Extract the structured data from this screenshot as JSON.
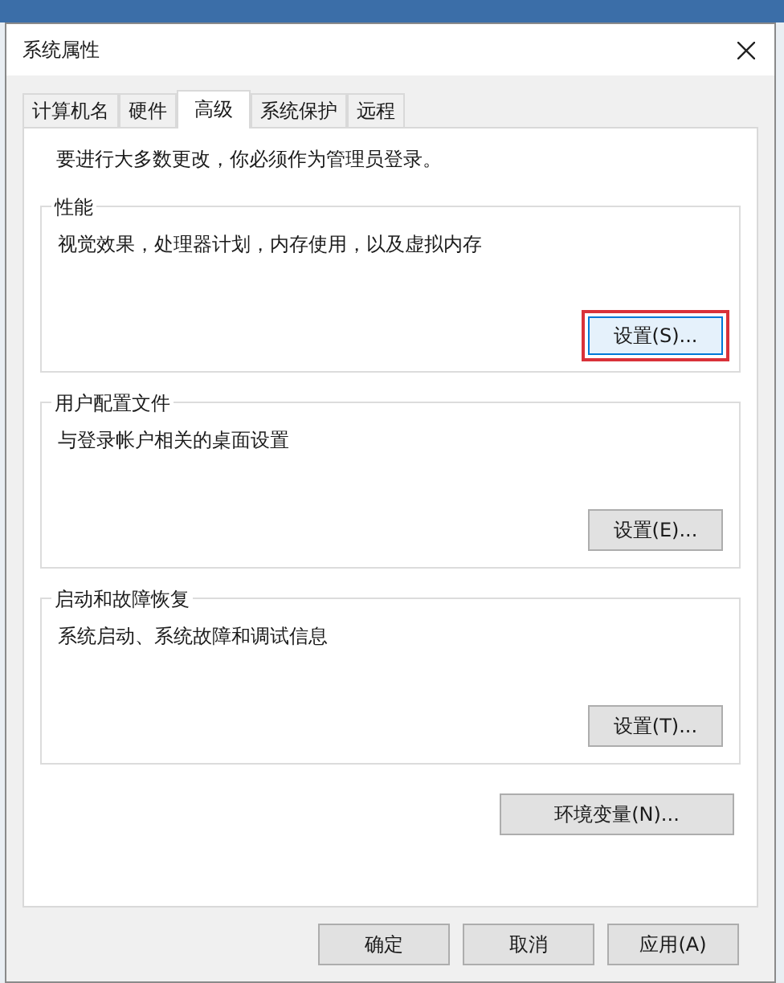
{
  "window": {
    "title": "系统属性"
  },
  "tabs": [
    {
      "label": "计算机名",
      "selected": false
    },
    {
      "label": "硬件",
      "selected": false
    },
    {
      "label": "高级",
      "selected": true
    },
    {
      "label": "系统保护",
      "selected": false
    },
    {
      "label": "远程",
      "selected": false
    }
  ],
  "notice": "要进行大多数更改，你必须作为管理员登录。",
  "groups": [
    {
      "title": "性能",
      "description": "视觉效果，处理器计划，内存使用，以及虚拟内存",
      "button": "设置(S)...",
      "highlighted": true
    },
    {
      "title": "用户配置文件",
      "description": "与登录帐户相关的桌面设置",
      "button": "设置(E)...",
      "highlighted": false
    },
    {
      "title": "启动和故障恢复",
      "description": "系统启动、系统故障和调试信息",
      "button": "设置(T)...",
      "highlighted": false
    }
  ],
  "env_button": "环境变量(N)...",
  "footer_buttons": [
    "确定",
    "取消",
    "应用(A)"
  ]
}
